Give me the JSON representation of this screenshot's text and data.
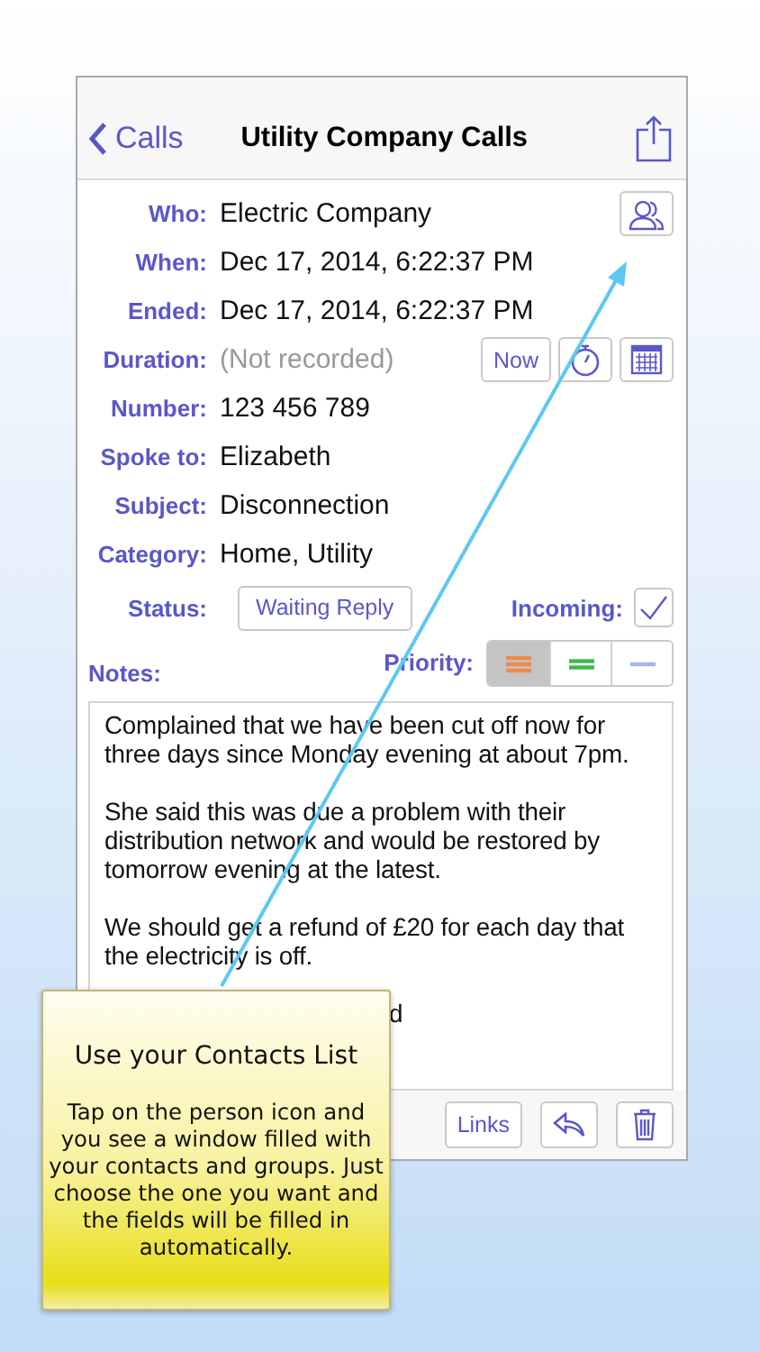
{
  "nav": {
    "back": "Calls",
    "title": "Utility Company Calls"
  },
  "fields": [
    {
      "label": "Who:",
      "value": "Electric Company",
      "actions": [
        {
          "kind": "contacts"
        }
      ]
    },
    {
      "label": "When:",
      "value": "Dec 17, 2014, 6:22:37 PM"
    },
    {
      "label": "Ended:",
      "value": "Dec 17, 2014, 6:22:37 PM"
    },
    {
      "label": "Duration:",
      "value": "(Not recorded)",
      "empty": true,
      "actions": [
        {
          "kind": "text",
          "label": "Now"
        },
        {
          "kind": "timer"
        },
        {
          "kind": "calendar"
        }
      ]
    },
    {
      "label": "Number:",
      "value": "123 456 789"
    },
    {
      "label": "Spoke to:",
      "value": "Elizabeth"
    },
    {
      "label": "Subject:",
      "value": "Disconnection"
    },
    {
      "label": "Category:",
      "value": "Home, Utility"
    }
  ],
  "status": {
    "label": "Status:",
    "value": "Waiting Reply"
  },
  "incoming": {
    "label": "Incoming:",
    "checked": true
  },
  "notes_label": "Notes:",
  "priority": {
    "label": "Priority:",
    "options": [
      {
        "kind": "high",
        "color": "#f0884a",
        "selected": true
      },
      {
        "kind": "medium",
        "color": "#3cba4a",
        "selected": false
      },
      {
        "kind": "low",
        "color": "#a8b4ec",
        "selected": false
      }
    ]
  },
  "notes": {
    "paragraphs": [
      "Complained that we have been cut off now for three days since Monday evening at about 7pm.",
      "She said this was due a problem with their distribution network and would be restored by tomorrow evening at the latest.",
      "We should get a refund of £20 for each day that the electricity is off."
    ],
    "fragment": "d"
  },
  "toolbar": [
    {
      "kind": "text",
      "label": "Links"
    },
    {
      "kind": "reply"
    },
    {
      "kind": "trash"
    }
  ],
  "tip": {
    "title": "Use your Contacts List",
    "body": "Tap on the person icon and you see a window filled with your contacts and groups. Just choose the one you want and the fields will be filled in automatically."
  }
}
